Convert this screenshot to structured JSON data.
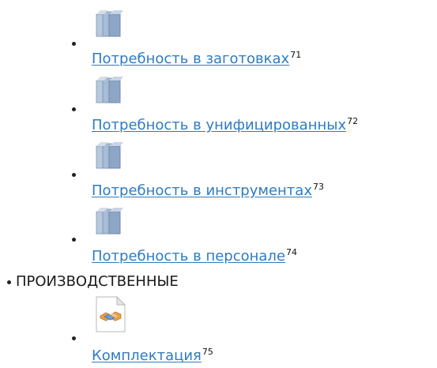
{
  "list": {
    "items": [
      {
        "label": "Потребность в заготовках",
        "ref": "71",
        "icon": "books-icon"
      },
      {
        "label": "Потребность в унифицированных",
        "ref": "72",
        "icon": "books-icon"
      },
      {
        "label": "Потребность в инструментах",
        "ref": "73",
        "icon": "books-icon"
      },
      {
        "label": "Потребность в персонале",
        "ref": "74",
        "icon": "books-icon"
      }
    ],
    "section": {
      "label": "ПРОИЗВОДСТВЕННЫЕ",
      "items": [
        {
          "label": "Комплектация",
          "ref": "75",
          "icon": "handshake-document-icon"
        }
      ]
    }
  },
  "colors": {
    "link": "#2e7bc0",
    "text": "#1a1a1a",
    "icon_blue": "#8aa3c4"
  }
}
